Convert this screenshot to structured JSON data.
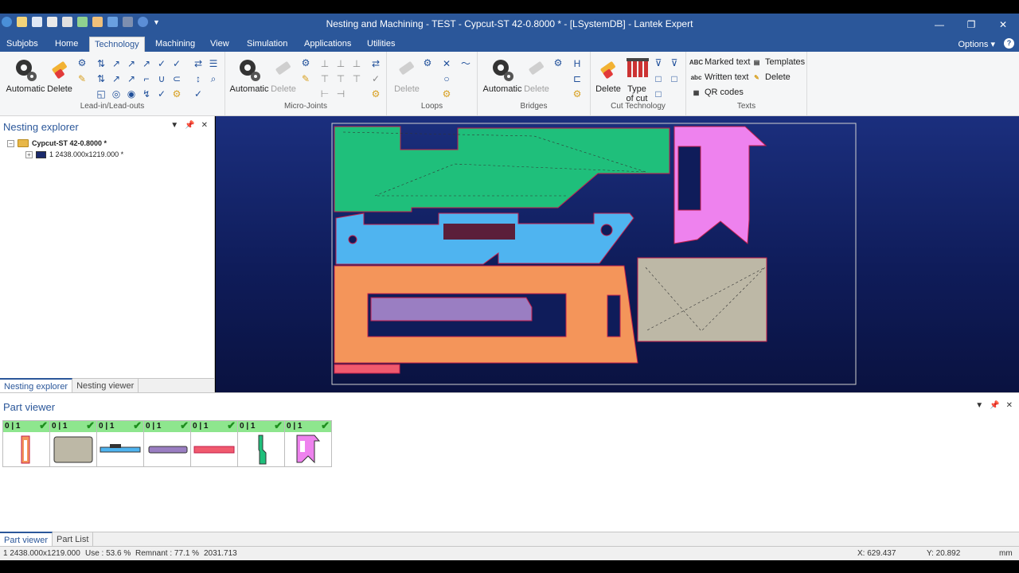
{
  "window": {
    "title": "Nesting and Machining - TEST - Cypcut-ST 42-0.8000 * - [LSystemDB] - Lantek Expert",
    "minimize": "—",
    "maximize": "❐",
    "close": "✕"
  },
  "menu": {
    "tabs": [
      "Subjobs",
      "Home",
      "Technology",
      "Machining",
      "View",
      "Simulation",
      "Applications",
      "Utilities"
    ],
    "active_tab": "Technology",
    "options": "Options",
    "help": "?"
  },
  "ribbon": {
    "groups": [
      {
        "label": "Lead-in/Lead-outs",
        "buttons": [
          "Automatic",
          "Delete"
        ]
      },
      {
        "label": "Micro-Joints",
        "buttons": [
          "Automatic",
          "Delete"
        ]
      },
      {
        "label": "Loops",
        "buttons": [
          "Delete"
        ]
      },
      {
        "label": "Bridges",
        "buttons": [
          "Automatic",
          "Delete"
        ]
      },
      {
        "label": "Cut Technology",
        "buttons": [
          "Delete",
          "Type of cut"
        ]
      },
      {
        "label": "Texts",
        "buttons": [
          "Marked text",
          "Written text",
          "QR codes",
          "Templates",
          "Delete"
        ]
      }
    ]
  },
  "nesting_explorer": {
    "title": "Nesting explorer",
    "root": "Cypcut-ST 42-0.8000 *",
    "child": "1 2438.000x1219.000 *",
    "tabs": [
      "Nesting explorer",
      "Nesting viewer"
    ]
  },
  "part_viewer": {
    "title": "Part viewer",
    "cards": [
      {
        "count": "0 | 1",
        "color": "#f4955a"
      },
      {
        "count": "0 | 1",
        "color": "#bdb8a6"
      },
      {
        "count": "0 | 1",
        "color": "#4fb4f0"
      },
      {
        "count": "0 | 1",
        "color": "#9a7ec2"
      },
      {
        "count": "0 | 1",
        "color": "#f05a6e"
      },
      {
        "count": "0 | 1",
        "color": "#1fbf7b"
      },
      {
        "count": "0 | 1",
        "color": "#ee82ee"
      }
    ],
    "tabs": [
      "Part viewer",
      "Part List"
    ]
  },
  "status": {
    "sheet": "1  2438.000x1219.000",
    "use": "Use : 53.6 %",
    "remnant": "Remnant : 77.1 %",
    "value": "2031.713",
    "x": "X: 629.437",
    "y": "Y: 20.892",
    "unit": "mm"
  },
  "colors": {
    "accent": "#2b579a",
    "part_green": "#1fbf7b",
    "part_blue": "#4fb4f0",
    "part_orange": "#f4955a",
    "part_purple": "#9a7ec2",
    "part_pink": "#ee82ee",
    "part_gray": "#bdb8a6",
    "part_red": "#f05a6e"
  }
}
